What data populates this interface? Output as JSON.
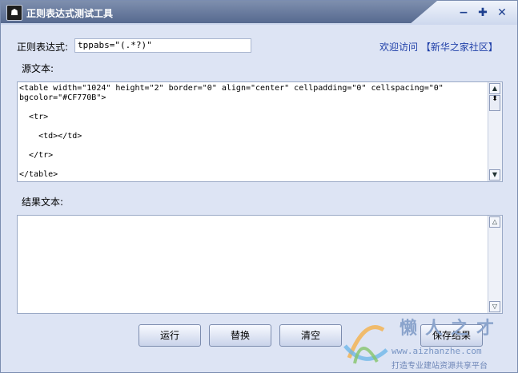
{
  "window": {
    "title": "正则表达式测试工具",
    "app_icon": "app-icon",
    "controls": {
      "minimize": "−",
      "maximize": "✚",
      "close": "✕"
    }
  },
  "regex": {
    "label": "正则表达式:",
    "value": "tppabs=\"(.*?)\""
  },
  "link": {
    "text": "欢迎访问 【新华之家社区】"
  },
  "source": {
    "label": "源文本:",
    "lines": [
      "<table width=\"1024\" height=\"2\" border=\"0\" align=\"center\" cellpadding=\"0\" cellspacing=\"0\"\nbgcolor=\"#CF770B\">",
      "",
      "  <tr>",
      "",
      "    <td></td>",
      "",
      "  </tr>",
      "",
      "</table>"
    ]
  },
  "result": {
    "label": "结果文本:",
    "value": ""
  },
  "buttons": {
    "run": "运行",
    "replace": "替换",
    "clear": "清空",
    "save": "保存结果"
  },
  "watermark": {
    "line1": "懒人之才",
    "line2": "www.aizhanzhe.com",
    "line3": "打造专业建站资源共享平台"
  },
  "colors": {
    "link": "#1f3fa8",
    "title_bar": "#5d7096"
  }
}
